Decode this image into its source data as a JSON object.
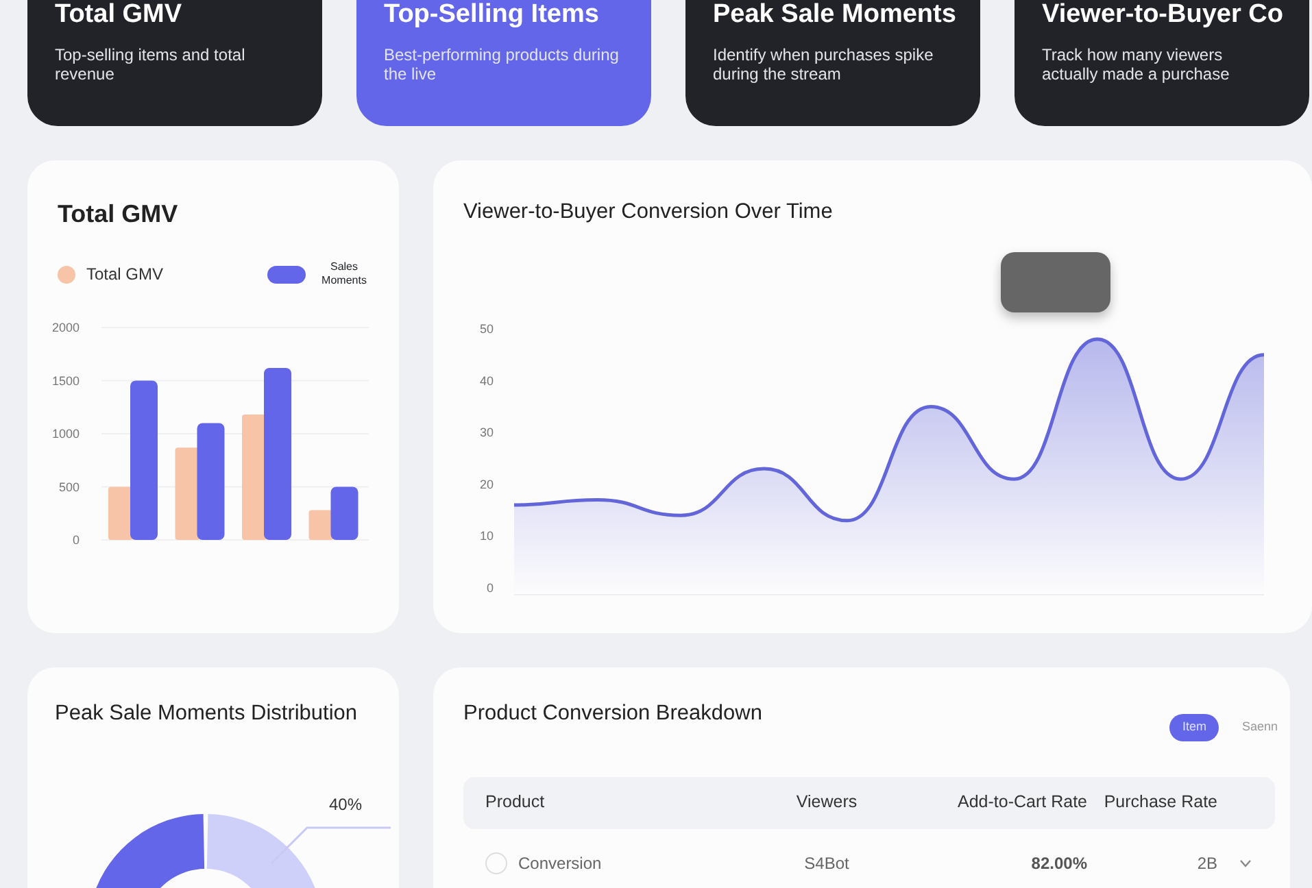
{
  "feature_cards": [
    {
      "title": "Total GMV",
      "description": "Top-selling items and total revenue",
      "selected": false
    },
    {
      "title": "Top-Selling Items",
      "description": "Best-performing products during the live",
      "selected": true
    },
    {
      "title": "Peak Sale Moments",
      "description": "Identify when purchases spike during the stream",
      "selected": false
    },
    {
      "title": "Viewer-to-Buyer Co",
      "description": "Track how many viewers actually made a purchase",
      "selected": false
    }
  ],
  "gmv_panel": {
    "title": "Total GMV",
    "chart_data": {
      "type": "bar",
      "grid": true,
      "yticks": [
        0,
        500,
        1000,
        1500,
        2000
      ],
      "ylim": [
        0,
        2000
      ],
      "categories": [
        null,
        null,
        null,
        null
      ],
      "series": [
        {
          "name": "Total GMV",
          "color": "#f7c4a8",
          "values": [
            500,
            870,
            1180,
            280
          ]
        },
        {
          "name": "Sales Moments",
          "color": "#6366e8",
          "values": [
            1500,
            1100,
            1620,
            500
          ]
        }
      ]
    }
  },
  "conversion_panel": {
    "title": "Viewer-to-Buyer Conversion Over Time",
    "chart_data": {
      "type": "area",
      "ylim": [
        0,
        50
      ],
      "yticks": [
        0,
        10,
        20,
        30,
        40,
        50
      ],
      "categories": [
        null,
        null,
        null,
        null,
        null,
        null,
        null,
        null,
        null,
        null
      ],
      "series": [
        {
          "color": "#6366d8",
          "values": [
            16,
            17,
            14,
            23,
            13,
            35,
            21,
            48,
            21,
            45
          ]
        }
      ]
    }
  },
  "distribution_panel": {
    "title": "Peak Sale Moments Distribution",
    "slice_label": "40%"
  },
  "breakdown_panel": {
    "title": "Product Conversion Breakdown",
    "toggle": [
      {
        "label": "Item",
        "selected": true
      },
      {
        "label": "Saenn",
        "selected": false
      }
    ],
    "table": {
      "columns": [
        "Product",
        "Viewers",
        "Add-to-Cart Rate",
        "Purchase Rate"
      ],
      "rows": [
        {
          "product": "Conversion",
          "viewers": "S4Bot",
          "add_to_cart": "82.00%",
          "purchase": "2B"
        }
      ]
    }
  }
}
